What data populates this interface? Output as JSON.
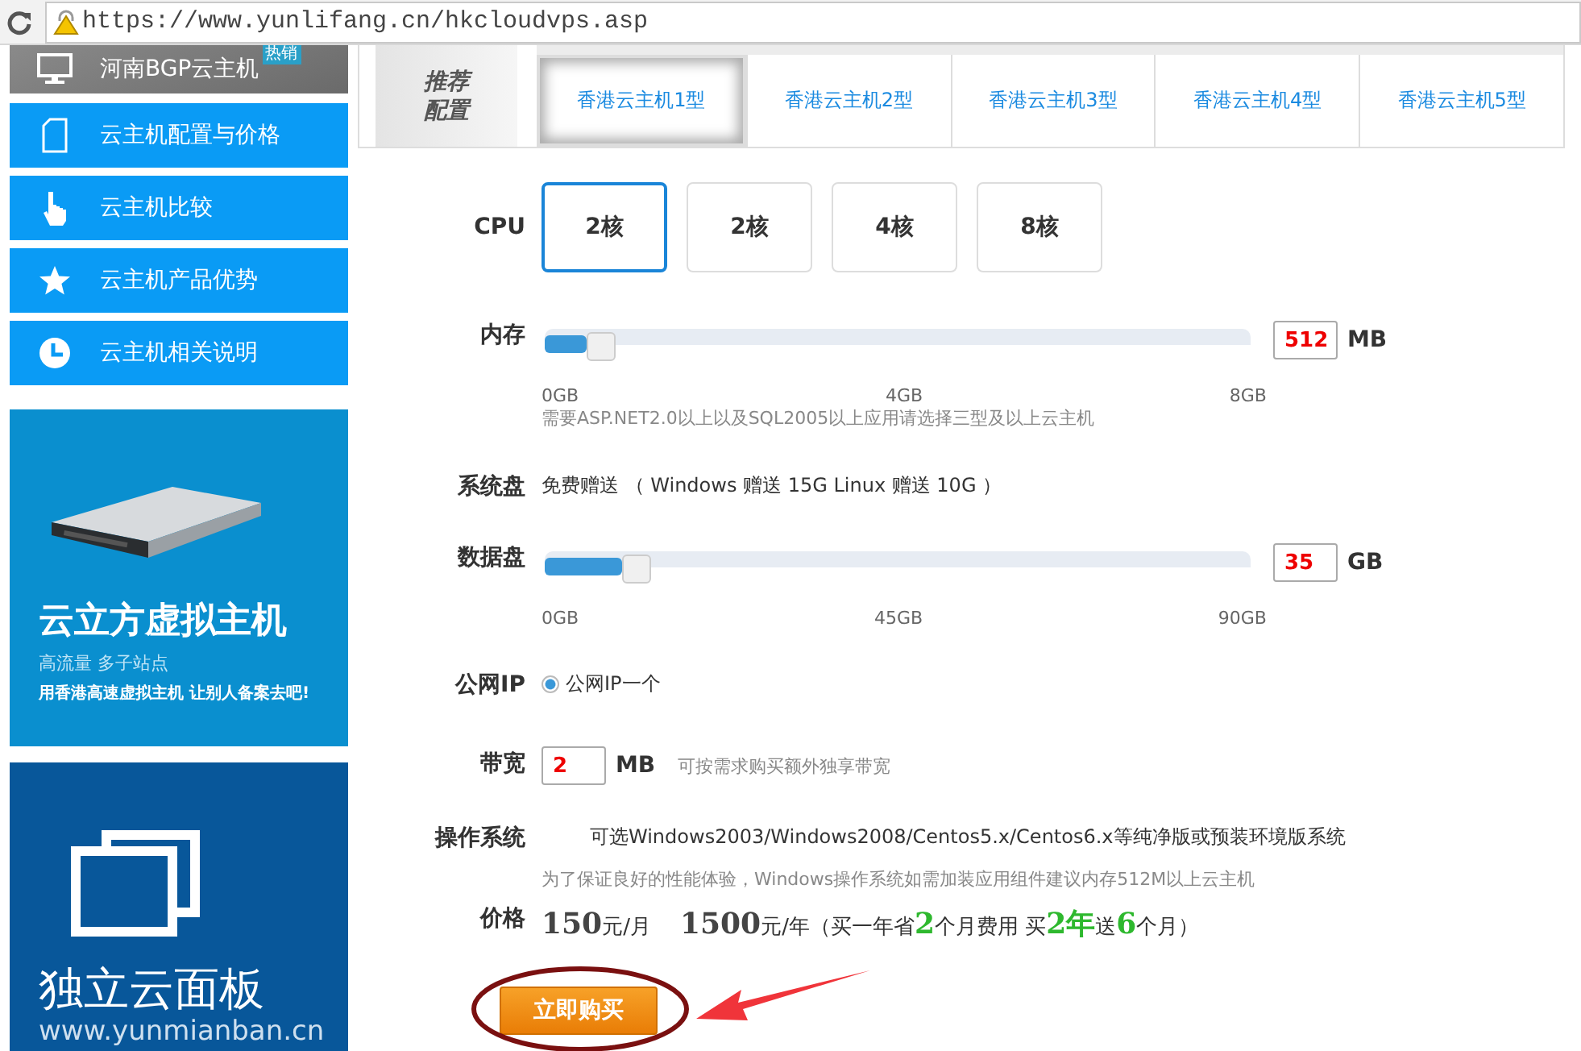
{
  "browser": {
    "url": "https://www.yunlifang.cn/hkcloudvps.asp"
  },
  "sidebar": {
    "items": [
      {
        "label": "河南BGP云主机",
        "badge": "热销",
        "kind": "header"
      },
      {
        "label": "云主机配置与价格",
        "kind": "item"
      },
      {
        "label": "云主机比较",
        "kind": "item"
      },
      {
        "label": "云主机产品优势",
        "kind": "item"
      },
      {
        "label": "云主机相关说明",
        "kind": "item"
      }
    ]
  },
  "banners": [
    {
      "kind": "server",
      "title": "云立方虚拟主机",
      "subtitle": "高流量 多子站点",
      "slogan": "用香港高速虚拟主机  让别人备案去吧!"
    },
    {
      "kind": "panel",
      "title": "独立云面板",
      "url": "www.yunmianban.cn"
    }
  ],
  "plans": {
    "label": "推荐配置",
    "tabs": [
      {
        "label": "香港云主机1型",
        "selected": true
      },
      {
        "label": "香港云主机2型",
        "selected": false
      },
      {
        "label": "香港云主机3型",
        "selected": false
      },
      {
        "label": "香港云主机4型",
        "selected": false
      },
      {
        "label": "香港云主机5型",
        "selected": false
      }
    ]
  },
  "cpu": {
    "label": "CPU",
    "options": [
      {
        "label": "2核",
        "selected": true
      },
      {
        "label": "2核",
        "selected": false
      },
      {
        "label": "4核",
        "selected": false
      },
      {
        "label": "8核",
        "selected": false
      }
    ]
  },
  "memory": {
    "label": "内存",
    "level": 0.06,
    "value": "512",
    "unit": "MB",
    "ticks": [
      "0GB",
      "4GB",
      "8GB"
    ],
    "note": "需要ASP.NET2.0以上以及SQL2005以上应用请选择三型及以上云主机"
  },
  "system_disk": {
    "label": "系统盘",
    "text": "免费赠送 （ Windows 赠送 15G Linux 赠送 10G ）"
  },
  "data_disk": {
    "label": "数据盘",
    "level": 0.11,
    "value": "35",
    "unit": "GB",
    "ticks": [
      "0GB",
      "45GB",
      "90GB"
    ]
  },
  "public_ip": {
    "label": "公网IP",
    "option": {
      "label": "公网IP一个",
      "selected": true
    }
  },
  "bandwidth": {
    "label": "带宽",
    "value": "2",
    "unit": "MB",
    "note": "可按需求购买额外独享带宽"
  },
  "os": {
    "label": "操作系统",
    "text": "可选Windows2003/Windows2008/Centos5.x/Centos6.x等纯净版或预装环境版系统",
    "note": "为了保证良好的性能体验，Windows操作系统如需加装应用组件建议内存512M以上云主机"
  },
  "price": {
    "label": "价格",
    "parts": [
      {
        "text": "150",
        "kind": "amount"
      },
      {
        "text": "元/月",
        "kind": "plain"
      },
      {
        "text": "1500",
        "kind": "amount"
      },
      {
        "text": "元/年（买一年省",
        "kind": "plain"
      },
      {
        "text": "2",
        "kind": "highlight"
      },
      {
        "text": "个月费用 买",
        "kind": "plain"
      },
      {
        "text": "2年",
        "kind": "highlight"
      },
      {
        "text": "送",
        "kind": "plain"
      },
      {
        "text": "6",
        "kind": "highlight"
      },
      {
        "text": "个月）",
        "kind": "plain"
      }
    ]
  },
  "buy_button": {
    "label": "立即购买"
  }
}
